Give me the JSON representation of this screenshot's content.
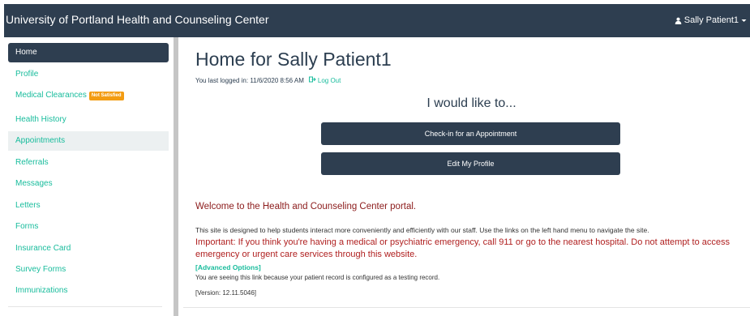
{
  "header": {
    "title": "University of Portland Health and Counseling Center",
    "user_label": "Sally Patient1",
    "user_icon": "user-icon",
    "caret_icon": "caret-down-icon"
  },
  "sidebar": {
    "items": [
      {
        "label": "Home",
        "state": "active"
      },
      {
        "label": "Profile"
      },
      {
        "label": "Medical Clearances",
        "badge": "Not Satisfied",
        "badge_color": "#f39c12"
      },
      {
        "label": "Health History"
      },
      {
        "label": "Appointments",
        "state": "hover"
      },
      {
        "label": "Referrals"
      },
      {
        "label": "Messages"
      },
      {
        "label": "Letters"
      },
      {
        "label": "Forms"
      },
      {
        "label": "Insurance Card"
      },
      {
        "label": "Survey Forms"
      },
      {
        "label": "Immunizations"
      }
    ]
  },
  "main": {
    "title": "Home for Sally Patient1",
    "last_login": "You last logged in: 11/6/2020 8:56 AM",
    "logout_label": "Log Out",
    "logout_icon": "sign-out-icon",
    "prompt": "I would like to...",
    "actions": [
      {
        "label": "Check-in for an Appointment"
      },
      {
        "label": "Edit My Profile"
      }
    ],
    "welcome": "Welcome to the Health and Counseling Center portal.",
    "description": "This site is designed to help students interact more conveniently and efficiently with our staff. Use the links on the left hand menu to navigate the site.",
    "important": "Important: If you think you're having a medical or psychiatric emergency, call 911 or go to the nearest hospital. Do not attempt to access emergency or urgent care services through this website.",
    "advanced_options": "[Advanced Options]",
    "testing_note": "You are seeing this link because your patient record is configured as a testing record.",
    "version": "[Version: 12.11.5046]"
  },
  "colors": {
    "navbar": "#2e3e50",
    "link": "#18bc9c",
    "badge": "#f39c12",
    "welcome": "#8b1a1a",
    "important": "#b02020"
  }
}
